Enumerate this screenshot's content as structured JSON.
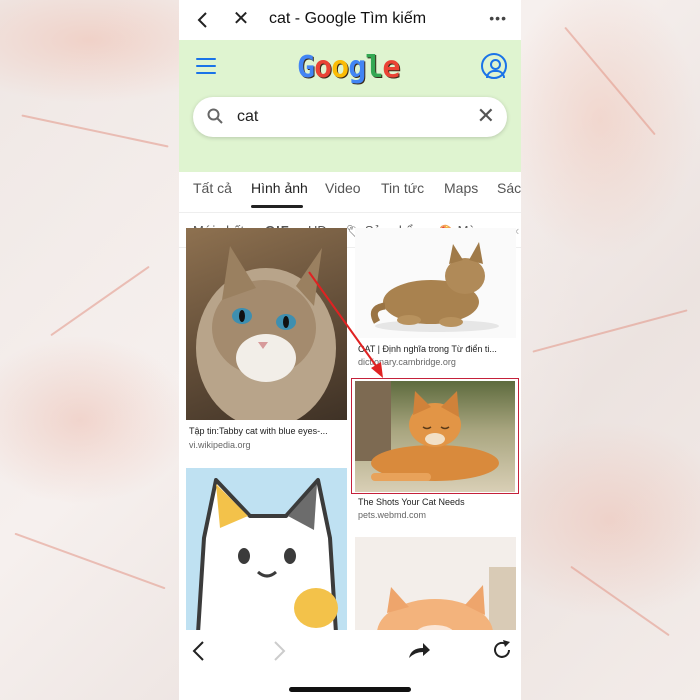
{
  "browser": {
    "title": "cat - Google Tìm kiếm",
    "more": "•••"
  },
  "header": {
    "logo_letters": [
      "G",
      "o",
      "o",
      "g",
      "l",
      "e"
    ],
    "background": "#dff4d0"
  },
  "search": {
    "value": "cat"
  },
  "tabs": [
    {
      "label": "Tất cả",
      "active": false
    },
    {
      "label": "Hình ảnh",
      "active": true
    },
    {
      "label": "Video",
      "active": false
    },
    {
      "label": "Tin tức",
      "active": false
    },
    {
      "label": "Maps",
      "active": false
    },
    {
      "label": "Sác",
      "active": false
    }
  ],
  "filters": [
    {
      "label": "Mới nhất"
    },
    {
      "label": "GIF"
    },
    {
      "label": "HD"
    },
    {
      "label": "Sản phẩm",
      "icon": "tag-icon"
    },
    {
      "label": "Màu",
      "icon": "palette-icon"
    }
  ],
  "results": [
    {
      "caption": "Tập tin:Tabby cat with blue eyes-...",
      "source": "vi.wikipedia.org"
    },
    {
      "caption": "CAT | Định nghĩa trong Từ điển ti...",
      "source": "dictionary.cambridge.org"
    },
    {
      "caption": "The Shots Your Cat Needs",
      "source": "pets.webmd.com",
      "highlighted": true
    }
  ],
  "colors": {
    "accent": "#1a73e8",
    "highlight": "#c4213a"
  }
}
